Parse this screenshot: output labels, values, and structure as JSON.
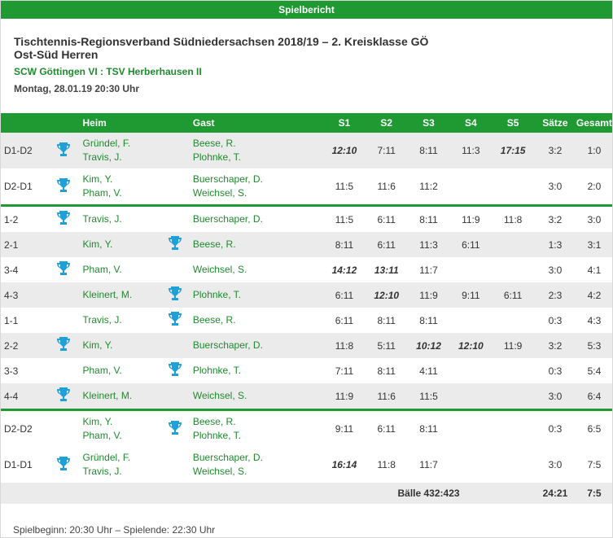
{
  "header": {
    "bar_title": "Spielbericht",
    "title_line1": "Tischtennis-Regionsverband Südniedersachsen 2018/19 – 2. Kreisklasse GÖ",
    "title_line2": "Ost-Süd Herren",
    "teams": "SCW Göttingen VI : TSV Herberhausen II",
    "date": "Montag, 28.01.19 20:30 Uhr"
  },
  "table": {
    "columns": {
      "heim": "Heim",
      "gast": "Gast",
      "s1": "S1",
      "s2": "S2",
      "s3": "S3",
      "s4": "S4",
      "s5": "S5",
      "saetze": "Sätze",
      "gesamt": "Gesamt"
    },
    "rows": [
      {
        "pair": "D1-D2",
        "heim1": "Gründel, F.",
        "heim2": "Travis, J.",
        "gast1": "Beese, R.",
        "gast2": "Plohnke, T.",
        "s1": "12:10",
        "s2": "7:11",
        "s3": "8:11",
        "s4": "11:3",
        "s5": "17:15",
        "saetze": "3:2",
        "gesamt": "1:0"
      },
      {
        "pair": "D2-D1",
        "heim1": "Kim, Y.",
        "heim2": "Pham, V.",
        "gast1": "Buerschaper, D.",
        "gast2": "Weichsel, S.",
        "s1": "11:5",
        "s2": "11:6",
        "s3": "11:2",
        "s4": "",
        "s5": "",
        "saetze": "3:0",
        "gesamt": "2:0"
      },
      {
        "pair": "1-2",
        "heim1": "Travis, J.",
        "gast1": "Buerschaper, D.",
        "s1": "11:5",
        "s2": "6:11",
        "s3": "8:11",
        "s4": "11:9",
        "s5": "11:8",
        "saetze": "3:2",
        "gesamt": "3:0"
      },
      {
        "pair": "2-1",
        "heim1": "Kim, Y.",
        "gast1": "Beese, R.",
        "s1": "8:11",
        "s2": "6:11",
        "s3": "11:3",
        "s4": "6:11",
        "s5": "",
        "saetze": "1:3",
        "gesamt": "3:1"
      },
      {
        "pair": "3-4",
        "heim1": "Pham, V.",
        "gast1": "Weichsel, S.",
        "s1": "14:12",
        "s2": "13:11",
        "s3": "11:7",
        "s4": "",
        "s5": "",
        "saetze": "3:0",
        "gesamt": "4:1"
      },
      {
        "pair": "4-3",
        "heim1": "Kleinert, M.",
        "gast1": "Plohnke, T.",
        "s1": "6:11",
        "s2": "12:10",
        "s3": "11:9",
        "s4": "9:11",
        "s5": "6:11",
        "saetze": "2:3",
        "gesamt": "4:2"
      },
      {
        "pair": "1-1",
        "heim1": "Travis, J.",
        "gast1": "Beese, R.",
        "s1": "6:11",
        "s2": "8:11",
        "s3": "8:11",
        "s4": "",
        "s5": "",
        "saetze": "0:3",
        "gesamt": "4:3"
      },
      {
        "pair": "2-2",
        "heim1": "Kim, Y.",
        "gast1": "Buerschaper, D.",
        "s1": "11:8",
        "s2": "5:11",
        "s3": "10:12",
        "s4": "12:10",
        "s5": "11:9",
        "saetze": "3:2",
        "gesamt": "5:3"
      },
      {
        "pair": "3-3",
        "heim1": "Pham, V.",
        "gast1": "Plohnke, T.",
        "s1": "7:11",
        "s2": "8:11",
        "s3": "4:11",
        "s4": "",
        "s5": "",
        "saetze": "0:3",
        "gesamt": "5:4"
      },
      {
        "pair": "4-4",
        "heim1": "Kleinert, M.",
        "gast1": "Weichsel, S.",
        "s1": "11:9",
        "s2": "11:6",
        "s3": "11:5",
        "s4": "",
        "s5": "",
        "saetze": "3:0",
        "gesamt": "6:4"
      },
      {
        "pair": "D2-D2",
        "heim1": "Kim, Y.",
        "heim2": "Pham, V.",
        "gast1": "Beese, R.",
        "gast2": "Plohnke, T.",
        "s1": "9:11",
        "s2": "6:11",
        "s3": "8:11",
        "s4": "",
        "s5": "",
        "saetze": "0:3",
        "gesamt": "6:5"
      },
      {
        "pair": "D1-D1",
        "heim1": "Gründel, F.",
        "heim2": "Travis, J.",
        "gast1": "Buerschaper, D.",
        "gast2": "Weichsel, S.",
        "s1": "16:14",
        "s2": "11:8",
        "s3": "11:7",
        "s4": "",
        "s5": "",
        "saetze": "3:0",
        "gesamt": "7:5"
      }
    ],
    "summary": {
      "baelle": "Bälle 432:423",
      "saetze": "24:21",
      "gesamt": "7:5"
    }
  },
  "footer": "Spielbeginn: 20:30 Uhr – Spielende: 22:30 Uhr",
  "icons": {
    "winner": "trophy-icon"
  },
  "colors": {
    "accent": "#1f9a32",
    "name": "#1f8a2e"
  }
}
